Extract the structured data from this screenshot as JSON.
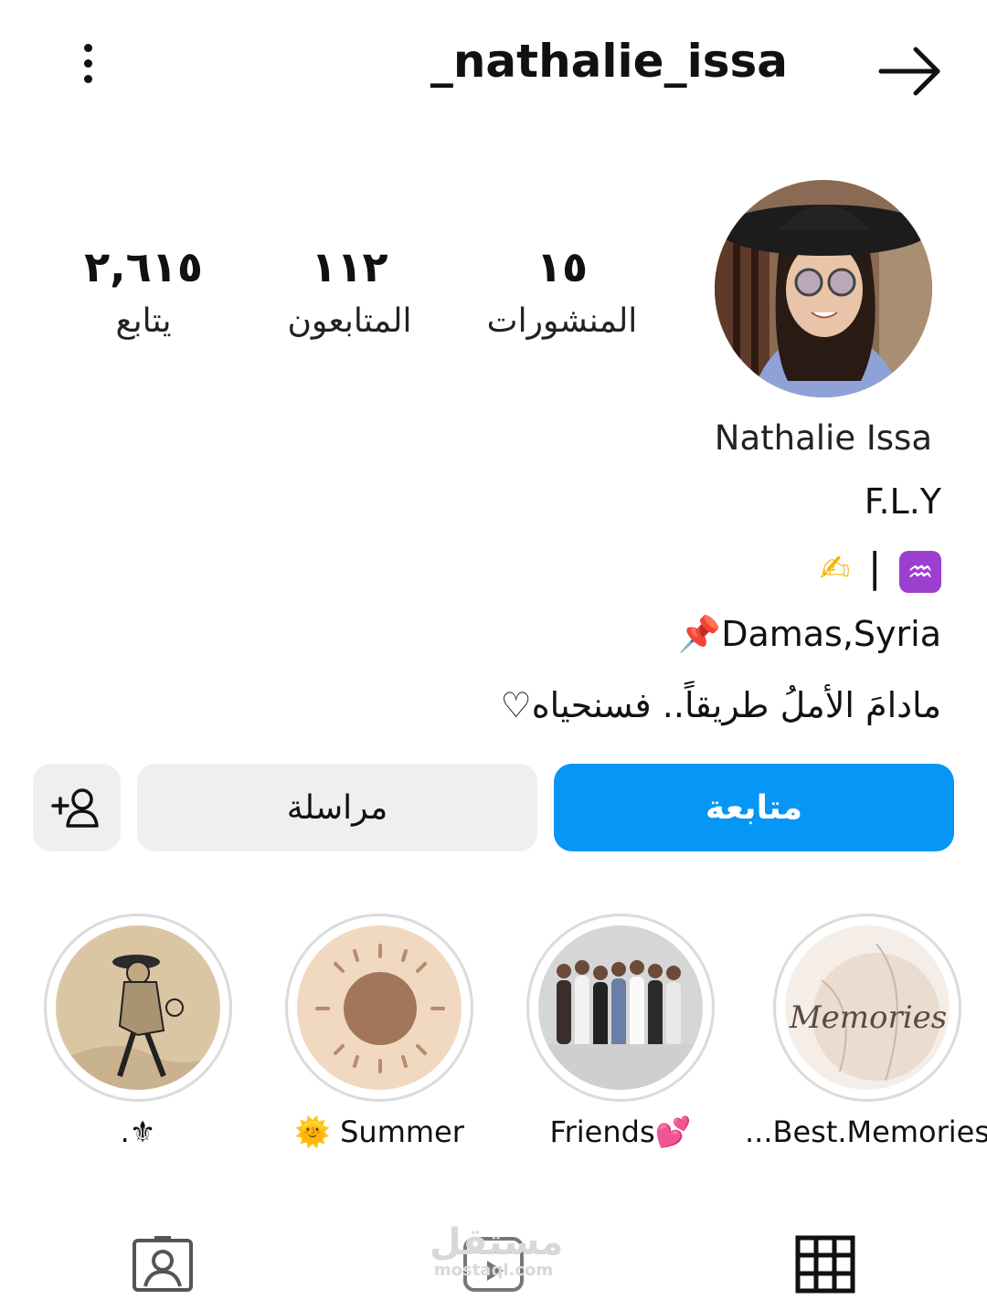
{
  "header": {
    "username": "_nathalie_issa",
    "menu_icon": "vertical-dots-icon",
    "forward_icon": "arrow-right-icon"
  },
  "stats": {
    "posts": {
      "value": "١٥",
      "label": "المنشورات"
    },
    "followers": {
      "value": "١١٢",
      "label": "المتابعون"
    },
    "following": {
      "value": "٢,٦١٥",
      "label": "يتابع"
    }
  },
  "profile": {
    "display_name": "Nathalie Issa",
    "bio_line1": "F.L.Y",
    "bio_line2_emoji_left": "✍",
    "bio_line2_separator": "|",
    "bio_line2_emoji_right": "♒",
    "bio_line3_pin": "📌",
    "bio_line3": "Damas,Syria",
    "bio_line4": "مادامَ الأملُ طريقاً.. فسنحياه♡"
  },
  "actions": {
    "follow_label": "متابعة",
    "message_label": "مراسلة",
    "add_user_icon": "add-person-icon"
  },
  "highlights": [
    {
      "label": ".⚜"
    },
    {
      "label": "🌞 Summer"
    },
    {
      "label": "Friends💕"
    },
    {
      "label": "...Best.Memories"
    }
  ],
  "highlight_art": {
    "memories_text": "Memories"
  },
  "watermark": {
    "main": "مستقل",
    "sub": "mostaql.com"
  },
  "colors": {
    "accent": "#0596f6",
    "button_gray": "#efefef"
  }
}
